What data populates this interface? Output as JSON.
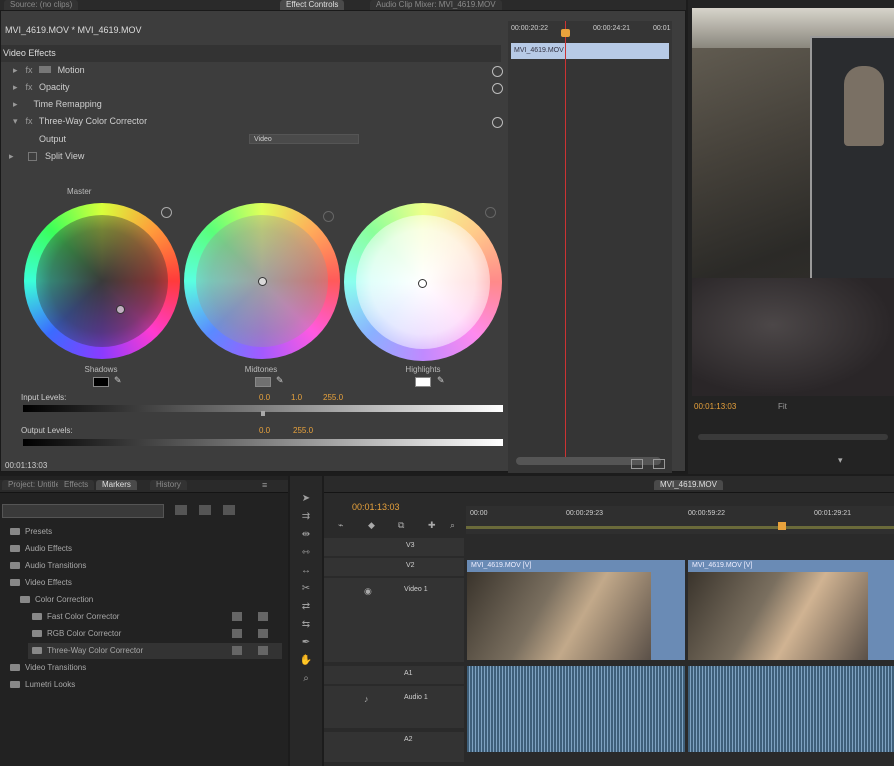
{
  "top_tabs": [
    {
      "label": "Source: (no clips)",
      "active": false
    },
    {
      "label": "Effect Controls",
      "active": true
    },
    {
      "label": "Audio Clip Mixer: MVI_4619.MOV",
      "active": false
    }
  ],
  "effect_controls": {
    "sequence_clip": "MVI_4619.MOV * MVI_4619.MOV",
    "section_title": "Video Effects",
    "effects": [
      {
        "name": "Motion",
        "fx": "fx"
      },
      {
        "name": "Opacity",
        "fx": "fx"
      },
      {
        "name": "Time Remapping",
        "fx": ""
      },
      {
        "name": "Three-Way Color Corrector",
        "fx": "fx"
      }
    ],
    "output_label": "Output",
    "output_value": "Video",
    "split_view_label": "Split View",
    "master_label": "Master",
    "wheels": [
      {
        "label": "Shadows",
        "swatch": "#000000"
      },
      {
        "label": "Midtones",
        "swatch": "#707070"
      },
      {
        "label": "Highlights",
        "swatch": "#ffffff"
      }
    ],
    "input_levels_label": "Input Levels:",
    "input_levels": [
      "0.0",
      "1.0",
      "255.0"
    ],
    "output_levels_label": "Output Levels:",
    "output_levels": [
      "0.0",
      "255.0"
    ],
    "timecode": "00:01:13:03",
    "ruler_times": [
      "00:00:20:22",
      "00:00:24:21",
      "00:01"
    ],
    "mini_clip": "MVI_4619.MOV",
    "bottom_icons": [
      "filter-icon",
      "export-icon"
    ]
  },
  "program_monitor": {
    "timecode": "00:01:13:03",
    "zoom": "Fit"
  },
  "project_panel": {
    "tabs": [
      "Project: Untitled",
      "Effects",
      "Markers",
      "History"
    ],
    "search_placeholder": "",
    "tree": [
      {
        "label": "Presets",
        "indent": 0
      },
      {
        "label": "Audio Effects",
        "indent": 0
      },
      {
        "label": "Audio Transitions",
        "indent": 0
      },
      {
        "label": "Video Effects",
        "indent": 0
      },
      {
        "label": "Color Correction",
        "indent": 1
      },
      {
        "label": "Fast Color Corrector",
        "indent": 2
      },
      {
        "label": "RGB Color Corrector",
        "indent": 2
      },
      {
        "label": "Three-Way Color Corrector",
        "indent": 2
      },
      {
        "label": "Video Transitions",
        "indent": 0
      },
      {
        "label": "Lumetri Looks",
        "indent": 0
      }
    ]
  },
  "timeline": {
    "tabs": [
      "MVI_4619.MOV"
    ],
    "timecode": "00:01:13:03",
    "ruler": [
      "00:00",
      "00:00:29:23",
      "00:00:59:22",
      "00:01:29:21"
    ],
    "tracks": [
      {
        "name": "V3"
      },
      {
        "name": "V2"
      },
      {
        "name": "Video 1"
      },
      {
        "name": "A1"
      },
      {
        "name": "Audio 1"
      },
      {
        "name": "A2"
      }
    ],
    "clips": [
      "MVI_4619.MOV [V]",
      "MVI_4619.MOV [V]"
    ]
  },
  "colors": {
    "accent": "#e8a23c",
    "panel": "#3d3d3d",
    "video_clip": "#6a8bb5",
    "audio_clip": "#3e5f7a",
    "selection": "#b7cae6"
  }
}
